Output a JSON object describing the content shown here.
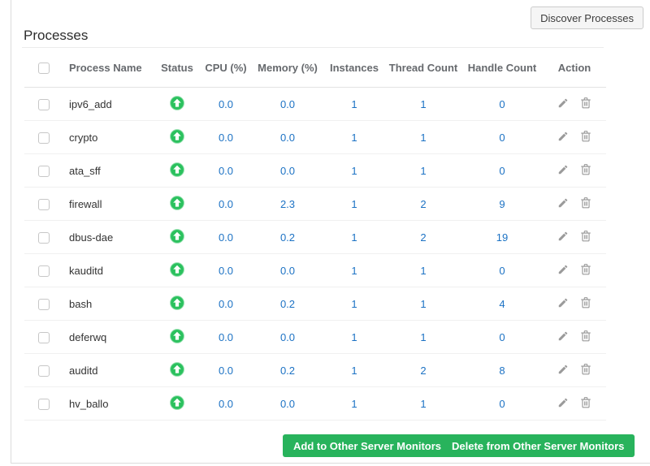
{
  "page": {
    "title": "Processes"
  },
  "toolbar": {
    "discover_label": "Discover Processes"
  },
  "table": {
    "columns": {
      "name": "Process Name",
      "status": "Status",
      "cpu": "CPU (%)",
      "memory": "Memory (%)",
      "instances": "Instances",
      "threads": "Thread Count",
      "handles": "Handle Count",
      "action": "Action"
    },
    "rows": [
      {
        "name": "ipv6_add",
        "status": "up",
        "cpu": "0.0",
        "memory": "0.0",
        "instances": "1",
        "threads": "1",
        "handles": "0"
      },
      {
        "name": "crypto",
        "status": "up",
        "cpu": "0.0",
        "memory": "0.0",
        "instances": "1",
        "threads": "1",
        "handles": "0"
      },
      {
        "name": "ata_sff",
        "status": "up",
        "cpu": "0.0",
        "memory": "0.0",
        "instances": "1",
        "threads": "1",
        "handles": "0"
      },
      {
        "name": "firewall",
        "status": "up",
        "cpu": "0.0",
        "memory": "2.3",
        "instances": "1",
        "threads": "2",
        "handles": "9"
      },
      {
        "name": "dbus-dae",
        "status": "up",
        "cpu": "0.0",
        "memory": "0.2",
        "instances": "1",
        "threads": "2",
        "handles": "19"
      },
      {
        "name": "kauditd",
        "status": "up",
        "cpu": "0.0",
        "memory": "0.0",
        "instances": "1",
        "threads": "1",
        "handles": "0"
      },
      {
        "name": "bash",
        "status": "up",
        "cpu": "0.0",
        "memory": "0.2",
        "instances": "1",
        "threads": "1",
        "handles": "4"
      },
      {
        "name": "deferwq",
        "status": "up",
        "cpu": "0.0",
        "memory": "0.0",
        "instances": "1",
        "threads": "1",
        "handles": "0"
      },
      {
        "name": "auditd",
        "status": "up",
        "cpu": "0.0",
        "memory": "0.2",
        "instances": "1",
        "threads": "2",
        "handles": "8"
      },
      {
        "name": "hv_ballo",
        "status": "up",
        "cpu": "0.0",
        "memory": "0.0",
        "instances": "1",
        "threads": "1",
        "handles": "0"
      }
    ]
  },
  "footer": {
    "add_label": "Add to Other Server Monitors",
    "delete_label": "Delete from Other Server Monitors"
  },
  "icons": {
    "status_up": "green-circle-up-arrow",
    "edit": "pencil",
    "delete": "trash-can"
  },
  "colors": {
    "accent_green": "#28b35c",
    "status_green": "#2bc15e",
    "link_blue": "#1c72c4",
    "icon_gray": "#9a9a9a"
  }
}
